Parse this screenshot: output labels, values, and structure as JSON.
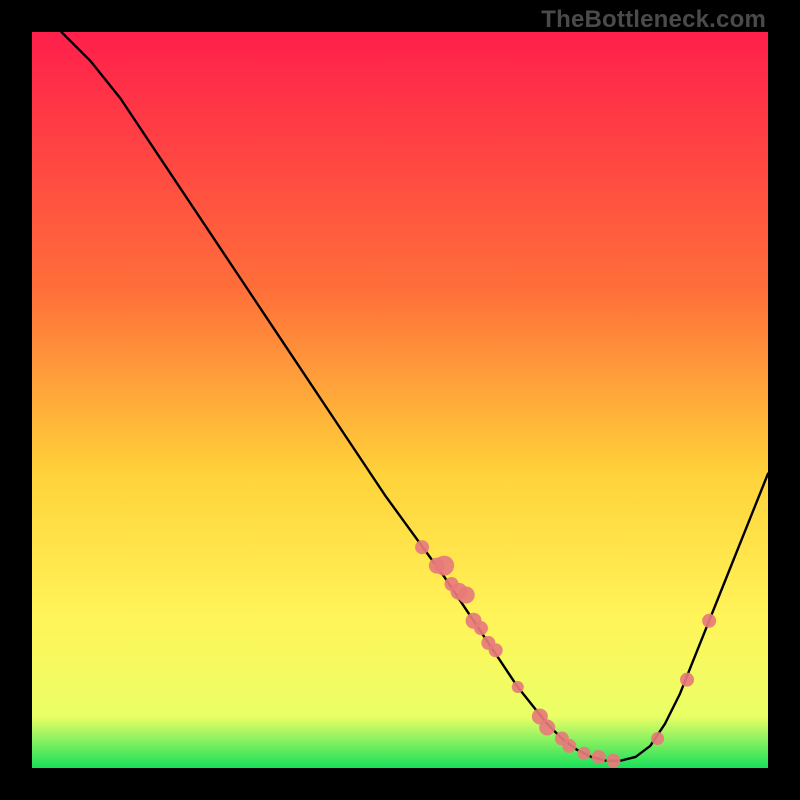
{
  "watermark": "TheBottleneck.com",
  "chart_data": {
    "type": "line",
    "title": "",
    "xlabel": "",
    "ylabel": "",
    "xlim": [
      0,
      100
    ],
    "ylim": [
      0,
      100
    ],
    "grid": false,
    "legend": false,
    "gradient_stops": [
      {
        "offset": 0,
        "color": "#ff1f4b"
      },
      {
        "offset": 35,
        "color": "#ff6f3a"
      },
      {
        "offset": 60,
        "color": "#ffd23a"
      },
      {
        "offset": 80,
        "color": "#fff55a"
      },
      {
        "offset": 93,
        "color": "#eaff66"
      },
      {
        "offset": 100,
        "color": "#18e05a"
      }
    ],
    "curve": {
      "x": [
        4,
        8,
        12,
        16,
        20,
        24,
        28,
        32,
        36,
        40,
        44,
        48,
        52,
        56,
        58,
        60,
        62,
        64,
        66,
        68,
        70,
        72,
        74,
        76,
        78,
        80,
        82,
        84,
        86,
        88,
        90,
        92,
        94,
        96,
        98,
        100
      ],
      "y": [
        100,
        96,
        91,
        85,
        79,
        73,
        67,
        61,
        55,
        49,
        43,
        37,
        31.5,
        26,
        23,
        20,
        17,
        14,
        11,
        8.5,
        6,
        4,
        2.5,
        1.5,
        1,
        1,
        1.5,
        3,
        6,
        10,
        15,
        20,
        25,
        30,
        35,
        40
      ]
    },
    "series": [
      {
        "name": "markers",
        "type": "scatter",
        "color": "#e77b7b",
        "x": [
          53,
          55,
          56,
          57,
          58,
          59,
          60,
          61,
          62,
          63,
          66,
          69,
          70,
          72,
          73,
          75,
          77,
          79,
          85,
          89,
          92
        ],
        "y": [
          30,
          27.5,
          27.5,
          25,
          24,
          23.5,
          20,
          19,
          17,
          16,
          11,
          7,
          5.5,
          4,
          3,
          2,
          1.5,
          1,
          4,
          12,
          20
        ],
        "sizes": [
          7,
          8,
          10,
          7,
          8.5,
          8.5,
          8,
          7,
          7,
          7,
          6,
          8,
          8,
          7,
          7,
          6.5,
          7,
          7,
          6.5,
          7,
          7
        ]
      }
    ]
  }
}
